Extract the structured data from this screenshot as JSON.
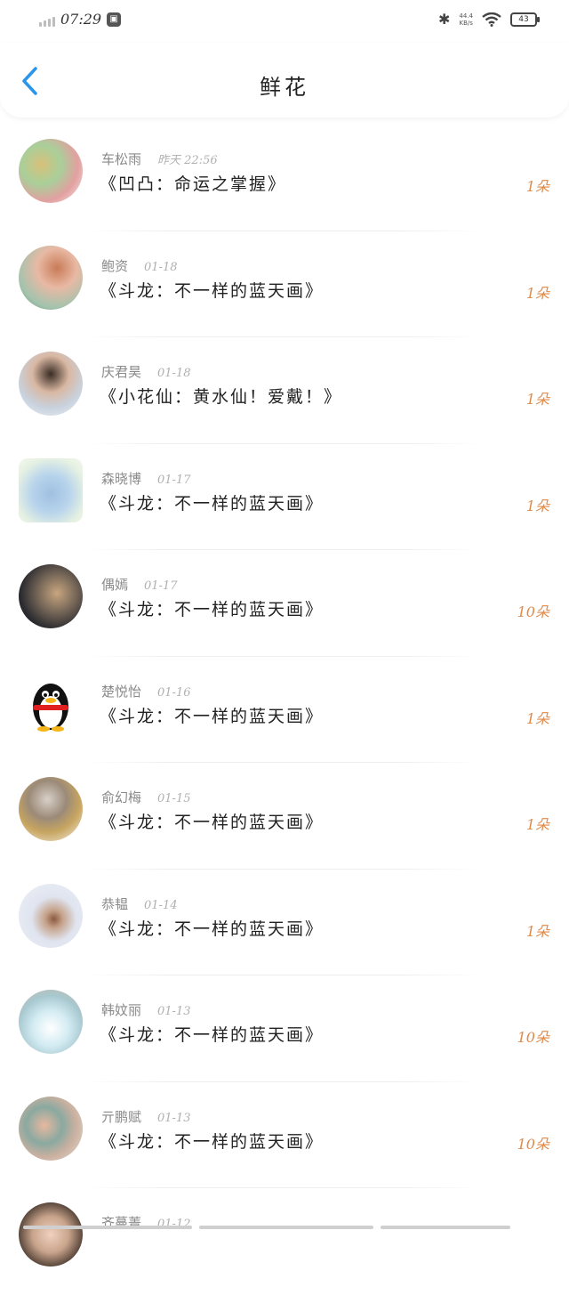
{
  "status_bar": {
    "time": "07:29",
    "net_speed_value": "44.4",
    "net_speed_unit": "KB/s",
    "battery": "43",
    "icons": [
      "signal-icon",
      "app-badge-icon",
      "bluetooth-icon",
      "wifi-icon",
      "battery-icon"
    ]
  },
  "header": {
    "back_icon": "chevron-left-icon",
    "title": "鲜花"
  },
  "colors": {
    "accent_blue": "#2b95e9",
    "count_orange": "#e08a4a",
    "name_gray": "#8a8a8a"
  },
  "items": [
    {
      "name": "车松雨",
      "date": "昨天 22:56",
      "title": "《凹凸：命运之掌握》",
      "count": "1朵"
    },
    {
      "name": "鲍资",
      "date": "01-18",
      "title": "《斗龙：不一样的蓝天画》",
      "count": "1朵"
    },
    {
      "name": "庆君昊",
      "date": "01-18",
      "title": "《小花仙：黄水仙！爱戴！》",
      "count": "1朵"
    },
    {
      "name": "森晓博",
      "date": "01-17",
      "title": "《斗龙：不一样的蓝天画》",
      "count": "1朵"
    },
    {
      "name": "偶嫣",
      "date": "01-17",
      "title": "《斗龙：不一样的蓝天画》",
      "count": "10朵"
    },
    {
      "name": "楚悦怡",
      "date": "01-16",
      "title": "《斗龙：不一样的蓝天画》",
      "count": "1朵"
    },
    {
      "name": "俞幻梅",
      "date": "01-15",
      "title": "《斗龙：不一样的蓝天画》",
      "count": "1朵"
    },
    {
      "name": "恭韫",
      "date": "01-14",
      "title": "《斗龙：不一样的蓝天画》",
      "count": "1朵"
    },
    {
      "name": "韩妏丽",
      "date": "01-13",
      "title": "《斗龙：不一样的蓝天画》",
      "count": "10朵"
    },
    {
      "name": "亓鹏赋",
      "date": "01-13",
      "title": "《斗龙：不一样的蓝天画》",
      "count": "10朵"
    },
    {
      "name": "齐蔓菁",
      "date": "01-12",
      "title": "",
      "count": ""
    }
  ]
}
